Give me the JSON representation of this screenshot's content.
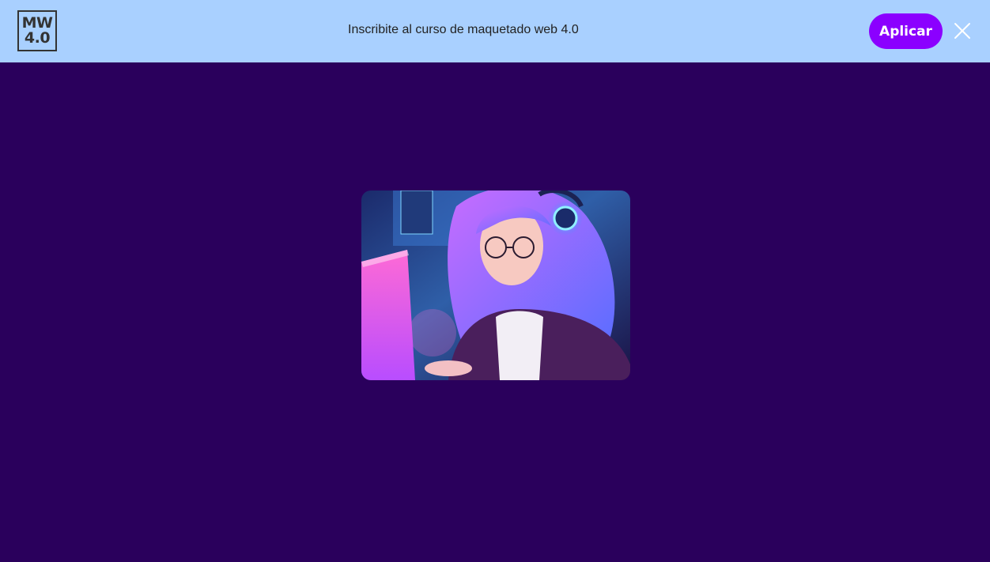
{
  "banner": {
    "logo": {
      "line1": "MW",
      "line2": "4.0"
    },
    "text": "Inscribite al curso de maquetado web 4.0",
    "apply_label": "Aplicar",
    "close_icon": "close-icon"
  },
  "colors": {
    "banner_bg": "#a9d0ff",
    "page_bg": "#2a005c",
    "accent": "#8b00ff"
  },
  "hero": {
    "image": "anime-girl-with-headphones-at-computer-illustration"
  }
}
